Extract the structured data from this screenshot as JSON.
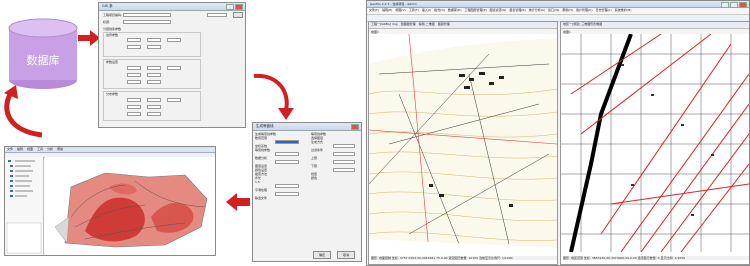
{
  "database": {
    "label": "数据库",
    "color": "#c7a0e6"
  },
  "params_window": {
    "title": "GIS 参",
    "rows": [
      "工程项目编码:",
      "标题:",
      "分层线条参数"
    ],
    "groups": [
      "边界参数",
      "参数设置",
      "分布参数"
    ]
  },
  "settings_window": {
    "title": "生成等值线",
    "left_items": [
      "生成等值线参数",
      "数值范围",
      "坐标系统",
      "等值线参数",
      "数据分析",
      "图层设置",
      "颜色设置",
      "插值方法",
      "步长",
      "1.5",
      "平滑处理",
      "输出文件"
    ],
    "right_items": [
      "等值线参数",
      "选择图层",
      "生成方式",
      "过滤条件",
      "上限",
      "下限",
      "线型",
      "颜色"
    ],
    "ok_label": "确定",
    "cancel_label": "取消"
  },
  "contour_app": {
    "menu": [
      "文件",
      "编辑",
      "视图",
      "工具",
      "分析",
      "帮助"
    ]
  },
  "gis_app": {
    "title": "GeoPro 2.2.7 - 当前项目 - admin",
    "menu": [
      "文件(F)",
      "编辑(E)",
      "视图(V)",
      "工具(T)",
      "插入(I)",
      "格式(O)",
      "数据库(D)",
      "工程图层管理(P)",
      "图表资源(G)",
      "报表管理(R)",
      "统计分析(S)",
      "窗口(W)",
      "帮助(H)",
      "用户管理(U)",
      "日志管理(L)",
      "系统维护(M)"
    ],
    "left_panel": {
      "toolbar_items": [
        "工程一[GREG] dog",
        "剖面图管理",
        "编辑-二维图",
        "图层管理"
      ],
      "tab_label": "地图1",
      "status": "图形: 地面控制  坐标: 3757.0152,30,3043461.75.0.00    选定图元数量: 10109   当前显示比例尺: 1/1000"
    },
    "right_panel": {
      "toolbar_items": [
        "地区一[测区] 三维图形影像图"
      ],
      "tab_label": "地图1",
      "status": "图形: 地区范围  坐标: 3853130,00,3974000,00,0.00   选定图元数量: 0    显示比例: 1/1000"
    }
  }
}
